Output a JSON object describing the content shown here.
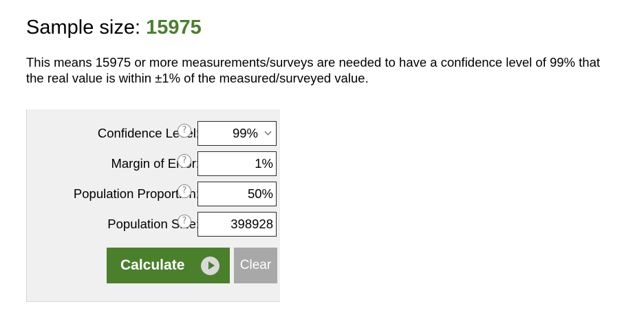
{
  "result": {
    "heading_label": "Sample size: ",
    "heading_value": "15975",
    "description": "This means 15975 or more measurements/surveys are needed to have a confidence level of 99% that the real value is within ±1% of the measured/surveyed value."
  },
  "form": {
    "help_glyph": "?",
    "fields": [
      {
        "label": "Confidence Level:",
        "value": "99%",
        "type": "select"
      },
      {
        "label": "Margin of Error:",
        "value": "1%",
        "type": "input"
      },
      {
        "label": "Population Proportion:",
        "value": "50%",
        "type": "input"
      },
      {
        "label": "Population Size:",
        "value": "398928",
        "type": "input"
      }
    ],
    "calculate_label": "Calculate",
    "clear_label": "Clear"
  },
  "colors": {
    "accent_green": "#4a7f2c",
    "clear_gray": "#a8a8a8",
    "panel_bg": "#f0f0f0"
  },
  "icons": {
    "help": "question-circle-icon",
    "calculate": "play-circle-icon",
    "select": "chevron-down-icon"
  }
}
